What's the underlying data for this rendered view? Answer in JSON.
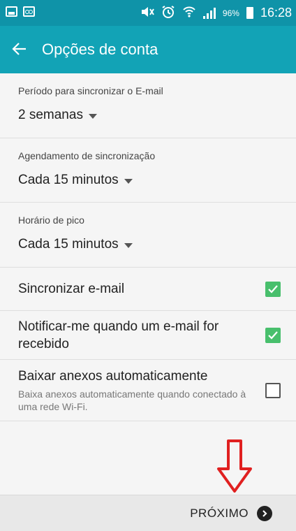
{
  "status_bar": {
    "battery": "96%",
    "time": "16:28"
  },
  "app_bar": {
    "title": "Opções de conta"
  },
  "settings": {
    "sync_period": {
      "label": "Período para sincronizar o E-mail",
      "value": "2 semanas"
    },
    "sync_schedule": {
      "label": "Agendamento de sincronização",
      "value": "Cada 15 minutos"
    },
    "peak_schedule": {
      "label": "Horário de pico",
      "value": "Cada 15 minutos"
    },
    "sync_email": {
      "label": "Sincronizar e-mail",
      "checked": true
    },
    "notify": {
      "label": "Notificar-me quando um e-mail for recebido",
      "checked": true
    },
    "download_attachments": {
      "label": "Baixar anexos automaticamente",
      "description": "Baixa anexos automaticamente quando conectado à uma rede Wi-Fi.",
      "checked": false
    }
  },
  "footer": {
    "next_label": "PRÓXIMO"
  },
  "colors": {
    "status_bar": "#0f93a8",
    "app_bar": "#12a3b6",
    "checkbox_on": "#48bf6c",
    "annotation_arrow": "#e02020"
  }
}
